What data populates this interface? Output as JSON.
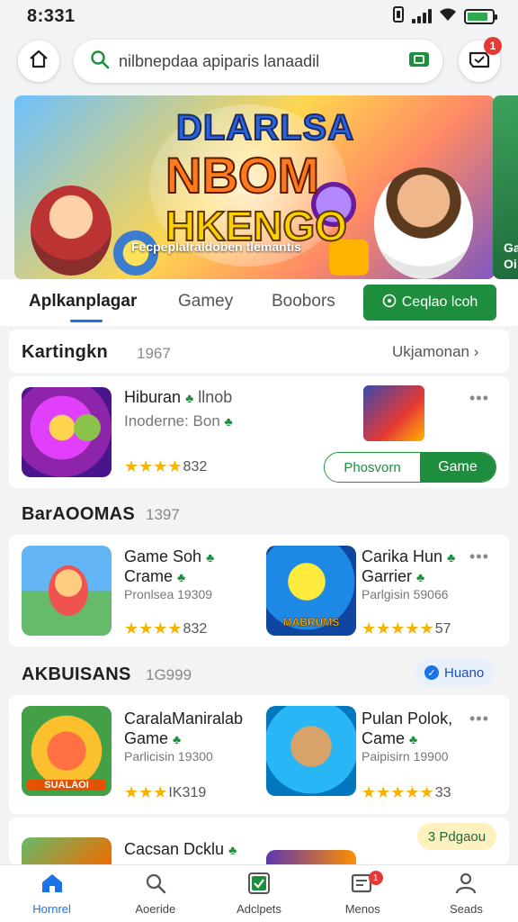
{
  "status_bar": {
    "time": "8:331",
    "battery_level": 0.85
  },
  "search": {
    "text": "nilbnepdaa apiparis lanaadil"
  },
  "header": {
    "notification_count": "1"
  },
  "banner": {
    "title_line1": "DLARLSA",
    "title_line2": "NBOM",
    "title_line3": "HKENGO",
    "subtitle": "Fecpeplalraldoben tlemantis",
    "peek_text": "Ga Oi"
  },
  "tabs": [
    {
      "label": "Aplkanplagar",
      "active": true
    },
    {
      "label": "Gamey",
      "active": false
    },
    {
      "label": "Boobors",
      "active": false
    }
  ],
  "cta_button": {
    "label": "Ceqlao lcoh"
  },
  "section1": {
    "title": "Kartingkn",
    "count": "1967",
    "see_all": "Ukjamonan",
    "app": {
      "name": "Hiburan",
      "name_suffix": "llnob",
      "meta": "Inoderne: Bon",
      "rating_value": "832",
      "stars": 4
    },
    "action_left": "Phosvorn",
    "action_right": "Game"
  },
  "section2": {
    "title": "BarAOOMAS",
    "count": "1397",
    "apps": [
      {
        "name_line1": "Game Soh",
        "name_line2": "Crame",
        "meta": "Pronlsea 19309",
        "stars": 4,
        "rating_value": "832"
      },
      {
        "name_line1": "Carika Hun",
        "name_line2": "Garrier",
        "meta": "Parlgisin 59066",
        "stars": 5,
        "rating_value": "57"
      }
    ],
    "thumb2_label": "MABRUMS"
  },
  "section3": {
    "title": "AKBUISANS",
    "count": "1G999",
    "badge": "Huano",
    "apps": [
      {
        "name_line1": "CaralaManiralab",
        "name_line2": "Game",
        "meta": "Parlicisin 19300",
        "stars": 3,
        "rating_value": "IK319"
      },
      {
        "name_line1": "Pulan Polok,",
        "name_line2": "Came",
        "meta": "Paipisirn 19900",
        "stars": 5,
        "rating_value": "33"
      }
    ],
    "thumb1_label": "SUALAOI"
  },
  "section4": {
    "app_name": "Cacsan Dcklu",
    "badge": "3 Pdgaou"
  },
  "bottom_nav": [
    {
      "label": "Hornrel",
      "icon": "home-icon",
      "active": true
    },
    {
      "label": "Aoeride",
      "icon": "explore-icon",
      "active": false
    },
    {
      "label": "Adclpets",
      "icon": "apps-check-icon",
      "active": false
    },
    {
      "label": "Menos",
      "icon": "message-icon",
      "active": false,
      "badge": "1"
    },
    {
      "label": "Seads",
      "icon": "profile-icon",
      "active": false
    }
  ],
  "colors": {
    "accent_green": "#1e8e3e",
    "accent_blue": "#1a73e8",
    "star": "#f4b400",
    "badge_red": "#e53935"
  }
}
